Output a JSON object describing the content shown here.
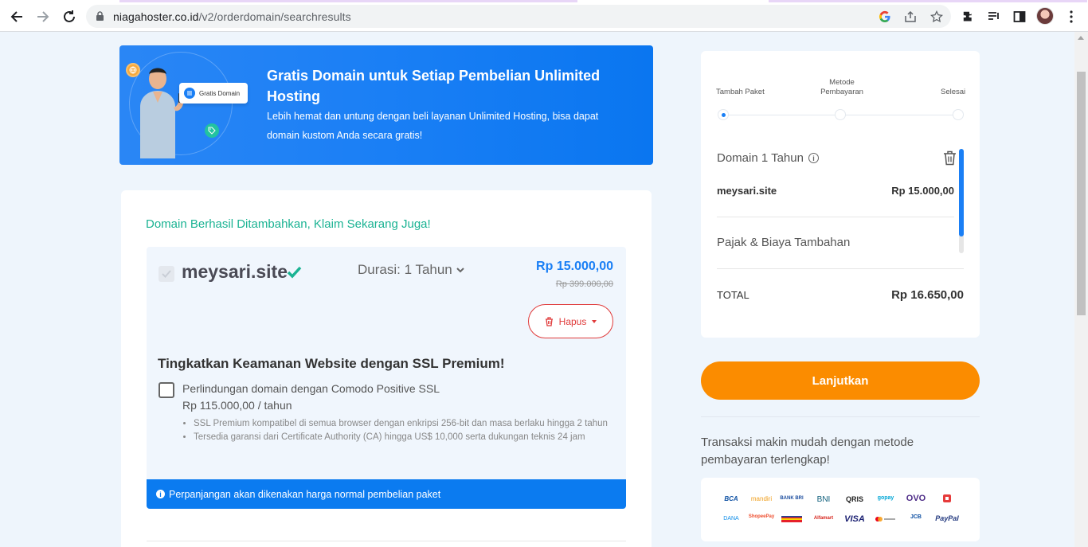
{
  "browser": {
    "url_host": "niagahoster.co.id",
    "url_path": "/v2/orderdomain/searchresults"
  },
  "banner": {
    "title": "Gratis Domain untuk Setiap Pembelian Unlimited Hosting",
    "description": "Lebih hemat dan untung dengan beli layanan Unlimited Hosting, bisa dapat domain kustom Anda secara gratis!",
    "chip_label": "Gratis Domain"
  },
  "cart": {
    "success_message": "Domain Berhasil Ditambahkan, Klaim Sekarang Juga!",
    "domain": "meysari.site",
    "duration_label": "Durasi: 1 Tahun",
    "price": "Rp 15.000,00",
    "old_price": "Rp 399.000,00",
    "remove_label": "Hapus",
    "ssl_title": "Tingkatkan Keamanan Website dengan SSL Premium!",
    "ssl_option_name": "Perlindungan domain dengan Comodo Positive SSL",
    "ssl_option_price": "Rp 115.000,00 / tahun",
    "ssl_features": [
      "SSL Premium kompatibel di semua browser dengan enkripsi 256-bit dan masa berlaku hingga 2 tahun",
      "Tersedia garansi dari Certificate Authority (CA) hingga US$ 10,000 serta dukungan teknis 24 jam"
    ],
    "notice": "Perpanjangan akan dikenakan harga normal pembelian paket"
  },
  "summary": {
    "steps": [
      "Tambah Paket",
      "Metode Pembayaran",
      "Selesai"
    ],
    "item_label": "Domain 1 Tahun",
    "item_domain": "meysari.site",
    "item_price": "Rp 15.000,00",
    "tax_label": "Pajak & Biaya Tambahan",
    "total_label": "TOTAL",
    "total_value": "Rp 16.650,00"
  },
  "next_button": "Lanjutkan",
  "payment": {
    "text": "Transaksi makin mudah dengan metode pembayaran terlengkap!",
    "logos": [
      "BCA",
      "mandiri",
      "BANK BRI",
      "BNI",
      "QRIS",
      "gopay",
      "OVO",
      "",
      "DANA",
      "ShopeePay",
      "",
      "Alfamart",
      "VISA",
      "",
      "JCB",
      "PayPal"
    ]
  },
  "colors": {
    "accent": "#1a7ff5",
    "success": "#1bb393",
    "danger": "#e03a3a",
    "cta": "#fb8c00"
  }
}
